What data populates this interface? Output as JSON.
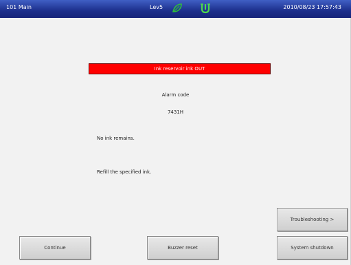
{
  "header": {
    "screen_title": "101 Main",
    "level": "Lev5",
    "datetime": "2010/08/23 17:57:43",
    "icons": [
      "leaf-icon",
      "plug-icon"
    ],
    "background_color": "#1d2f8c"
  },
  "alarm": {
    "title": "Ink reservoir ink OUT",
    "title_background": "#ff0000",
    "code_label": "Alarm code",
    "code_value": "7431H",
    "messages": [
      "No ink remains.",
      "Refill the specified ink."
    ]
  },
  "buttons": {
    "troubleshooting": "Troubleshooting >",
    "continue": "Continue",
    "buzzer_reset": "Buzzer reset",
    "system_shutdown": "System shutdown"
  }
}
